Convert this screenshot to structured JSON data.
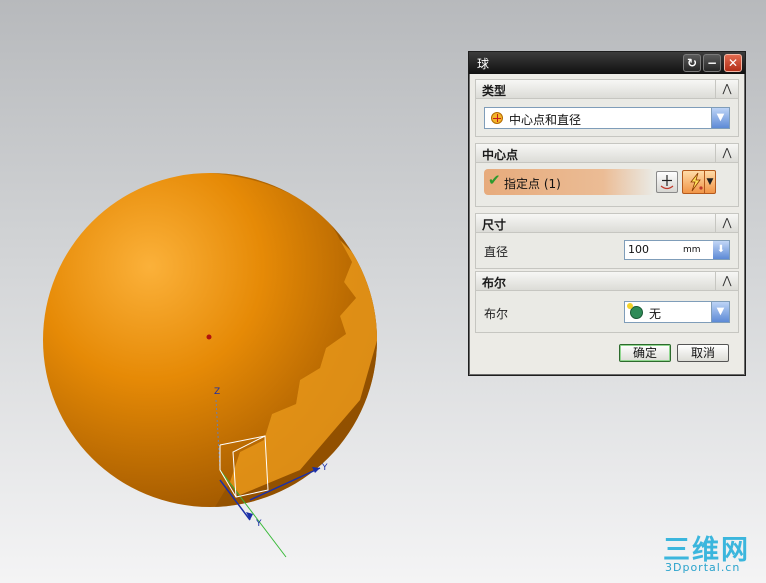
{
  "viewport": {
    "axes": {
      "z": "Z",
      "y": "Y",
      "x": "Y"
    }
  },
  "dialog": {
    "title": "球",
    "type_section": {
      "header": "类型",
      "selected": "中心点和直径"
    },
    "center_section": {
      "header": "中心点",
      "specify_point": "指定点 (1)"
    },
    "size_section": {
      "header": "尺寸",
      "diameter_label": "直径",
      "diameter_value": "100",
      "unit": "mm"
    },
    "boolean_section": {
      "header": "布尔",
      "label": "布尔",
      "selected": "无"
    },
    "ok_label": "确定",
    "cancel_label": "取消"
  },
  "watermark": {
    "main": "三维网",
    "sub": "3Dportal.cn"
  },
  "colors": {
    "sphere": "#f0960c",
    "title_bar": "#1a1a1a",
    "dropdown_accent": "#5d8ad6"
  }
}
